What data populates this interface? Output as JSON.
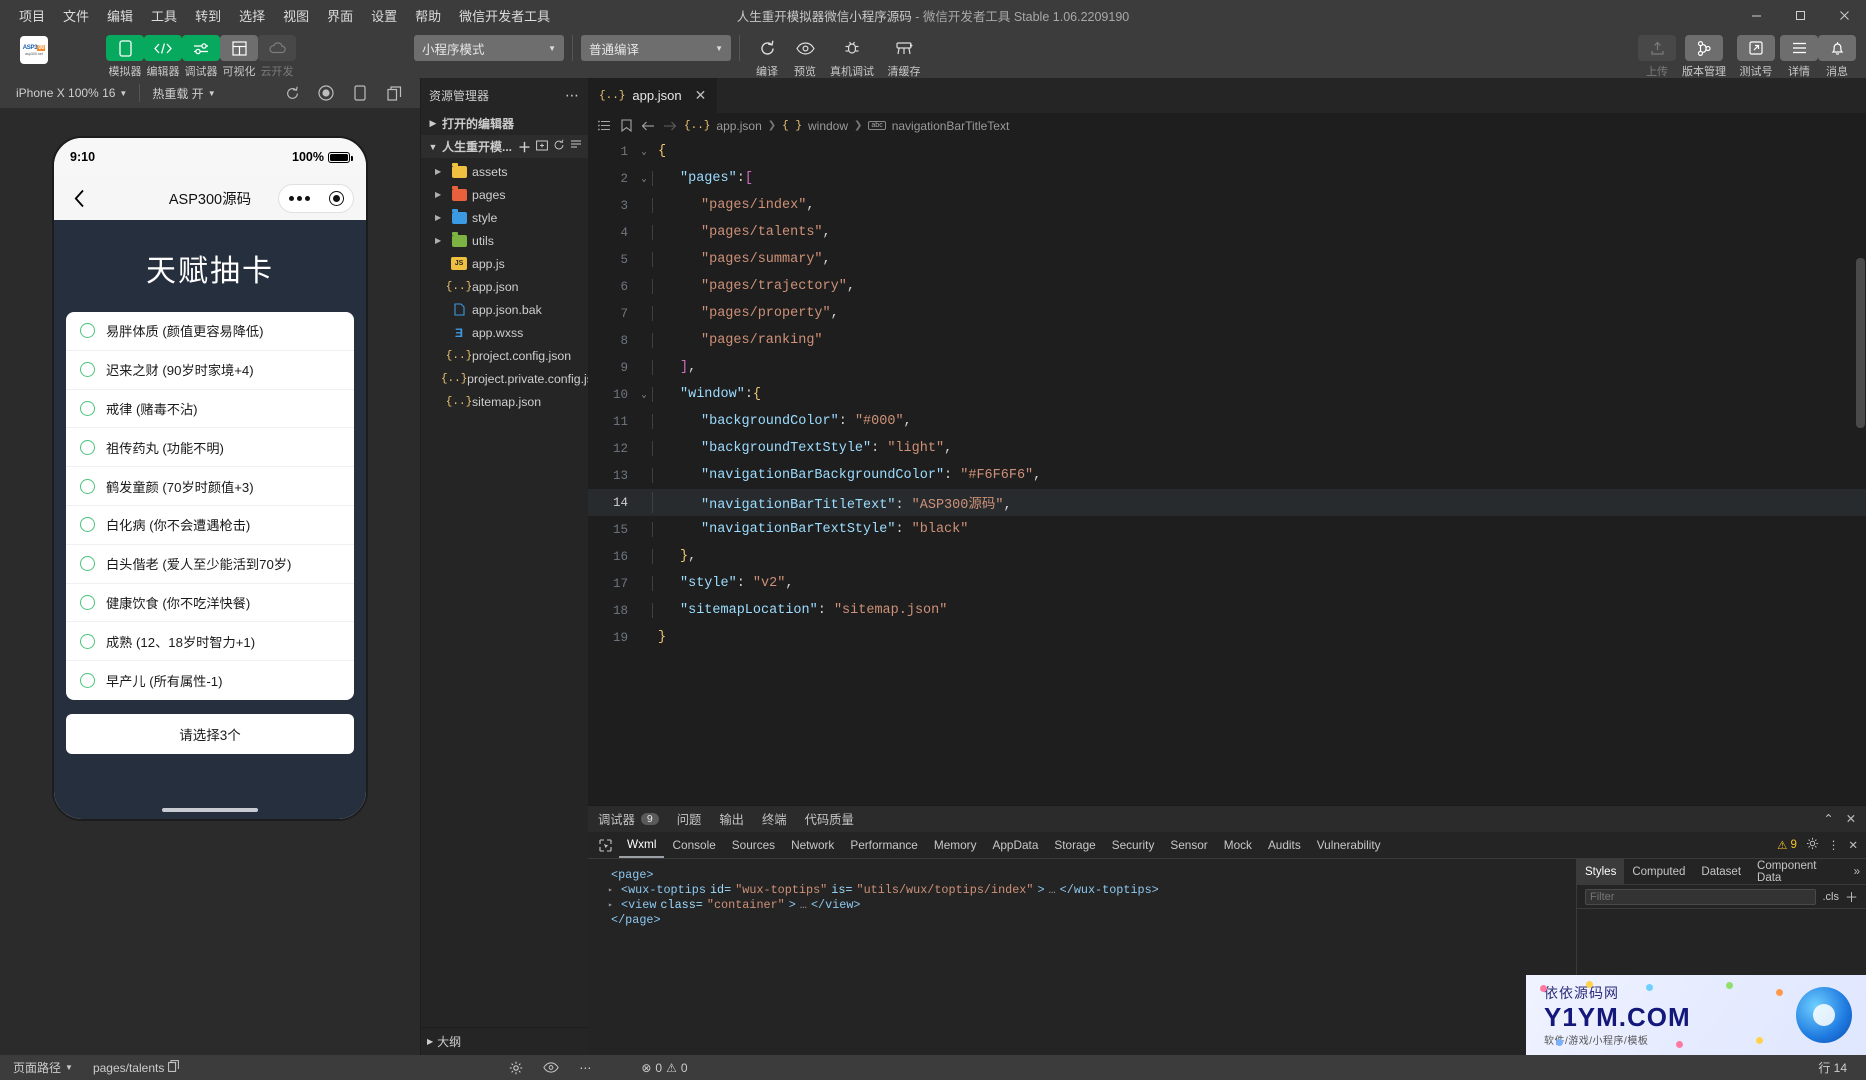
{
  "titlebar": {
    "menus": [
      "项目",
      "文件",
      "编辑",
      "工具",
      "转到",
      "选择",
      "视图",
      "界面",
      "设置",
      "帮助",
      "微信开发者工具"
    ],
    "project_title": "人生重开模拟器微信小程序源码",
    "app_title": " - 微信开发者工具 Stable 1.06.2209190"
  },
  "toolbar": {
    "logo_text": "ASP300",
    "logo_sub": "asp300.net",
    "left_buttons": [
      {
        "label": "模拟器",
        "icon": "phone-icon",
        "style": "green"
      },
      {
        "label": "编辑器",
        "icon": "code-icon",
        "style": "green"
      },
      {
        "label": "调试器",
        "icon": "sliders-icon",
        "style": "green"
      },
      {
        "label": "可视化",
        "icon": "layout-icon",
        "style": "grey"
      },
      {
        "label": "云开发",
        "icon": "cloud-icon",
        "style": "dim"
      }
    ],
    "mode_select": "小程序模式",
    "compile_select": "普通编译",
    "center_buttons": [
      {
        "label": "编译",
        "icon": "refresh-icon"
      },
      {
        "label": "预览",
        "icon": "eye-icon"
      },
      {
        "label": "真机调试",
        "icon": "bug-icon"
      },
      {
        "label": "清缓存",
        "icon": "broom-icon"
      }
    ],
    "right_buttons": [
      {
        "label": "上传",
        "icon": "upload-icon"
      },
      {
        "label": "版本管理",
        "icon": "branch-icon"
      },
      {
        "label": "测试号",
        "icon": "external-link-icon"
      },
      {
        "label": "详情",
        "icon": "menu-icon"
      },
      {
        "label": "消息",
        "icon": "bell-icon"
      }
    ]
  },
  "simulator": {
    "device": "iPhone X 100% 16",
    "hot_reload": "热重载 开",
    "phone": {
      "time": "9:10",
      "battery": "100%",
      "nav_title": "ASP300源码",
      "page_title": "天赋抽卡",
      "talents": [
        "易胖体质 (颜值更容易降低)",
        "迟来之财 (90岁时家境+4)",
        "戒律 (赌毒不沾)",
        "祖传药丸 (功能不明)",
        "鹤发童颜 (70岁时颜值+3)",
        "白化病 (你不会遭遇枪击)",
        "白头偕老 (爱人至少能活到70岁)",
        "健康饮食 (你不吃洋快餐)",
        "成熟 (12、18岁时智力+1)",
        "早产儿 (所有属性-1)"
      ],
      "select_button": "请选择3个"
    }
  },
  "explorer": {
    "title": "资源管理器",
    "open_editors": "打开的编辑器",
    "project_name": "人生重开模...",
    "outline": "大纲",
    "items": [
      {
        "name": "assets",
        "type": "folder",
        "color": "#f0c040",
        "expandable": true
      },
      {
        "name": "pages",
        "type": "folder",
        "color": "#e8603c",
        "expandable": true
      },
      {
        "name": "style",
        "type": "folder",
        "color": "#3b9ae1",
        "expandable": true
      },
      {
        "name": "utils",
        "type": "folder",
        "color": "#7cb342",
        "expandable": true
      },
      {
        "name": "app.js",
        "type": "js",
        "color": "#f0c040",
        "expandable": false
      },
      {
        "name": "app.json",
        "type": "json",
        "color": "#f0c040",
        "expandable": false
      },
      {
        "name": "app.json.bak",
        "type": "file",
        "color": "#3b9ae1",
        "expandable": false
      },
      {
        "name": "app.wxss",
        "type": "wxss",
        "color": "#3b9ae1",
        "expandable": false
      },
      {
        "name": "project.config.json",
        "type": "json",
        "color": "#f0c040",
        "expandable": false
      },
      {
        "name": "project.private.config.js...",
        "type": "json",
        "color": "#f0c040",
        "expandable": false
      },
      {
        "name": "sitemap.json",
        "type": "json",
        "color": "#f0c040",
        "expandable": false
      }
    ]
  },
  "editor": {
    "tab_name": "app.json",
    "breadcrumb": [
      "app.json",
      "window",
      "navigationBarTitleText"
    ],
    "current_line": 14,
    "lines": [
      {
        "n": 1,
        "fold": "v",
        "indent": 0,
        "tokens": [
          {
            "t": "{",
            "c": "k-brace"
          }
        ]
      },
      {
        "n": 2,
        "fold": "v",
        "indent": 1,
        "tokens": [
          {
            "t": "\"pages\"",
            "c": "k-key"
          },
          {
            "t": ":",
            "c": "k-punc"
          },
          {
            "t": "[",
            "c": "k-brack"
          }
        ]
      },
      {
        "n": 3,
        "fold": "",
        "indent": 2,
        "tokens": [
          {
            "t": "\"pages/index\"",
            "c": "k-str"
          },
          {
            "t": ",",
            "c": "k-punc"
          }
        ]
      },
      {
        "n": 4,
        "fold": "",
        "indent": 2,
        "tokens": [
          {
            "t": "\"pages/talents\"",
            "c": "k-str"
          },
          {
            "t": ",",
            "c": "k-punc"
          }
        ]
      },
      {
        "n": 5,
        "fold": "",
        "indent": 2,
        "tokens": [
          {
            "t": "\"pages/summary\"",
            "c": "k-str"
          },
          {
            "t": ",",
            "c": "k-punc"
          }
        ]
      },
      {
        "n": 6,
        "fold": "",
        "indent": 2,
        "tokens": [
          {
            "t": "\"pages/trajectory\"",
            "c": "k-str"
          },
          {
            "t": ",",
            "c": "k-punc"
          }
        ]
      },
      {
        "n": 7,
        "fold": "",
        "indent": 2,
        "tokens": [
          {
            "t": "\"pages/property\"",
            "c": "k-str"
          },
          {
            "t": ",",
            "c": "k-punc"
          }
        ]
      },
      {
        "n": 8,
        "fold": "",
        "indent": 2,
        "tokens": [
          {
            "t": "\"pages/ranking\"",
            "c": "k-str"
          }
        ]
      },
      {
        "n": 9,
        "fold": "",
        "indent": 1,
        "tokens": [
          {
            "t": "]",
            "c": "k-brack"
          },
          {
            "t": ",",
            "c": "k-punc"
          }
        ]
      },
      {
        "n": 10,
        "fold": "v",
        "indent": 1,
        "tokens": [
          {
            "t": "\"window\"",
            "c": "k-key"
          },
          {
            "t": ":",
            "c": "k-punc"
          },
          {
            "t": "{",
            "c": "k-brace"
          }
        ]
      },
      {
        "n": 11,
        "fold": "",
        "indent": 2,
        "tokens": [
          {
            "t": "\"backgroundColor\"",
            "c": "k-key"
          },
          {
            "t": ": ",
            "c": "k-punc"
          },
          {
            "t": "\"#000\"",
            "c": "k-str"
          },
          {
            "t": ",",
            "c": "k-punc"
          }
        ]
      },
      {
        "n": 12,
        "fold": "",
        "indent": 2,
        "tokens": [
          {
            "t": "\"backgroundTextStyle\"",
            "c": "k-key"
          },
          {
            "t": ": ",
            "c": "k-punc"
          },
          {
            "t": "\"light\"",
            "c": "k-str"
          },
          {
            "t": ",",
            "c": "k-punc"
          }
        ]
      },
      {
        "n": 13,
        "fold": "",
        "indent": 2,
        "tokens": [
          {
            "t": "\"navigationBarBackgroundColor\"",
            "c": "k-key"
          },
          {
            "t": ": ",
            "c": "k-punc"
          },
          {
            "t": "\"#F6F6F6\"",
            "c": "k-str"
          },
          {
            "t": ",",
            "c": "k-punc"
          }
        ]
      },
      {
        "n": 14,
        "fold": "",
        "indent": 2,
        "tokens": [
          {
            "t": "\"navigationBarTitleText\"",
            "c": "k-key"
          },
          {
            "t": ": ",
            "c": "k-punc"
          },
          {
            "t": "\"ASP300源码\"",
            "c": "k-str"
          },
          {
            "t": ",",
            "c": "k-punc"
          }
        ]
      },
      {
        "n": 15,
        "fold": "",
        "indent": 2,
        "tokens": [
          {
            "t": "\"navigationBarTextStyle\"",
            "c": "k-key"
          },
          {
            "t": ": ",
            "c": "k-punc"
          },
          {
            "t": "\"black\"",
            "c": "k-str"
          }
        ]
      },
      {
        "n": 16,
        "fold": "",
        "indent": 1,
        "tokens": [
          {
            "t": "}",
            "c": "k-brace"
          },
          {
            "t": ",",
            "c": "k-punc"
          }
        ]
      },
      {
        "n": 17,
        "fold": "",
        "indent": 1,
        "tokens": [
          {
            "t": "\"style\"",
            "c": "k-key"
          },
          {
            "t": ": ",
            "c": "k-punc"
          },
          {
            "t": "\"v2\"",
            "c": "k-str"
          },
          {
            "t": ",",
            "c": "k-punc"
          }
        ]
      },
      {
        "n": 18,
        "fold": "",
        "indent": 1,
        "tokens": [
          {
            "t": "\"sitemapLocation\"",
            "c": "k-key"
          },
          {
            "t": ": ",
            "c": "k-punc"
          },
          {
            "t": "\"sitemap.json\"",
            "c": "k-str"
          }
        ]
      },
      {
        "n": 19,
        "fold": "",
        "indent": 0,
        "tokens": [
          {
            "t": "}",
            "c": "k-brace"
          }
        ]
      }
    ]
  },
  "devtools": {
    "panel_tabs": [
      {
        "label": "调试器",
        "badge": "9"
      },
      {
        "label": "问题",
        "badge": ""
      },
      {
        "label": "输出",
        "badge": ""
      },
      {
        "label": "终端",
        "badge": ""
      },
      {
        "label": "代码质量",
        "badge": ""
      }
    ],
    "tabs": [
      "Wxml",
      "Console",
      "Sources",
      "Network",
      "Performance",
      "Memory",
      "AppData",
      "Storage",
      "Security",
      "Sensor",
      "Mock",
      "Audits",
      "Vulnerability"
    ],
    "active_tab": "Wxml",
    "warning_count": "9",
    "dom": [
      {
        "arrow": "",
        "depth": 0,
        "parts": [
          {
            "t": "<page>",
            "c": "dom-tag"
          }
        ]
      },
      {
        "arrow": "▸",
        "depth": 1,
        "parts": [
          {
            "t": "<wux-toptips ",
            "c": "dom-tag"
          },
          {
            "t": "id=",
            "c": "dom-attr"
          },
          {
            "t": "\"wux-toptips\"",
            "c": "dom-val"
          },
          {
            "t": " is=",
            "c": "dom-attr"
          },
          {
            "t": "\"utils/wux/toptips/index\"",
            "c": "dom-val"
          },
          {
            "t": ">",
            "c": "dom-tag"
          },
          {
            "t": "…",
            "c": "dom-ellip"
          },
          {
            "t": "</wux-toptips>",
            "c": "dom-tag"
          }
        ]
      },
      {
        "arrow": "▸",
        "depth": 1,
        "parts": [
          {
            "t": "<view ",
            "c": "dom-tag"
          },
          {
            "t": "class=",
            "c": "dom-attr"
          },
          {
            "t": "\"container\"",
            "c": "dom-val"
          },
          {
            "t": ">",
            "c": "dom-tag"
          },
          {
            "t": "…",
            "c": "dom-ellip"
          },
          {
            "t": "</view>",
            "c": "dom-tag"
          }
        ]
      },
      {
        "arrow": "",
        "depth": 0,
        "parts": [
          {
            "t": "</page>",
            "c": "dom-tag"
          }
        ]
      }
    ],
    "styles_tabs": [
      "Styles",
      "Computed",
      "Dataset",
      "Component Data"
    ],
    "styles_active": "Styles",
    "filter_placeholder": "Filter",
    "cls_label": ".cls"
  },
  "watermark": {
    "line1": "依依源码网",
    "line2": "Y1YM.COM",
    "line3": "软件/游戏/小程序/模板"
  },
  "statusbar": {
    "page_path_label": "页面路径",
    "page_path": "pages/talents",
    "errors": "0",
    "warnings": "0",
    "position": "行 14"
  }
}
